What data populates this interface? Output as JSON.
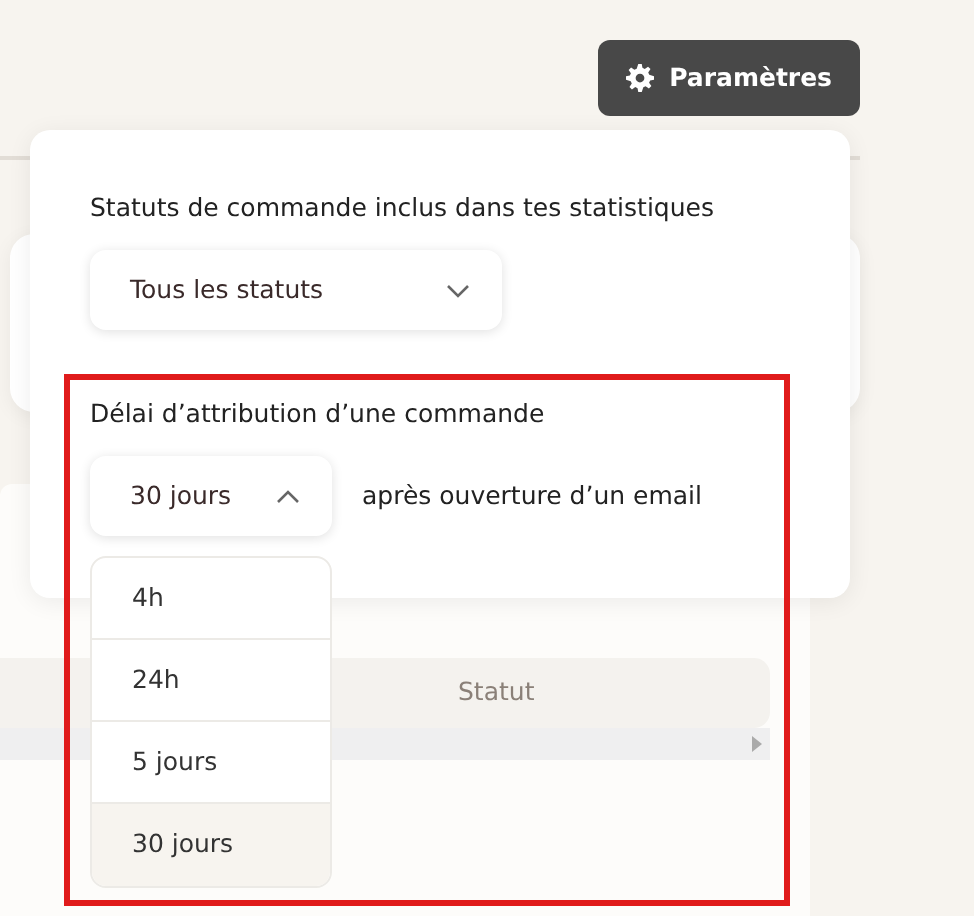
{
  "toolbar": {
    "settings_button": "Paramètres"
  },
  "popover": {
    "status_filter": {
      "label": "Statuts de commande inclus dans tes statistiques",
      "value": "Tous les statuts",
      "expanded": false
    },
    "attribution_delay": {
      "label": "Délai d’attribution d’une commande",
      "value": "30 jours",
      "expanded": true,
      "suffix": "après ouverture d’un email",
      "options": [
        {
          "label": "4h",
          "selected": false
        },
        {
          "label": "24h",
          "selected": false
        },
        {
          "label": "5 jours",
          "selected": false
        },
        {
          "label": "30 jours",
          "selected": true
        }
      ]
    }
  },
  "table": {
    "columns": [
      "Statut"
    ]
  }
}
